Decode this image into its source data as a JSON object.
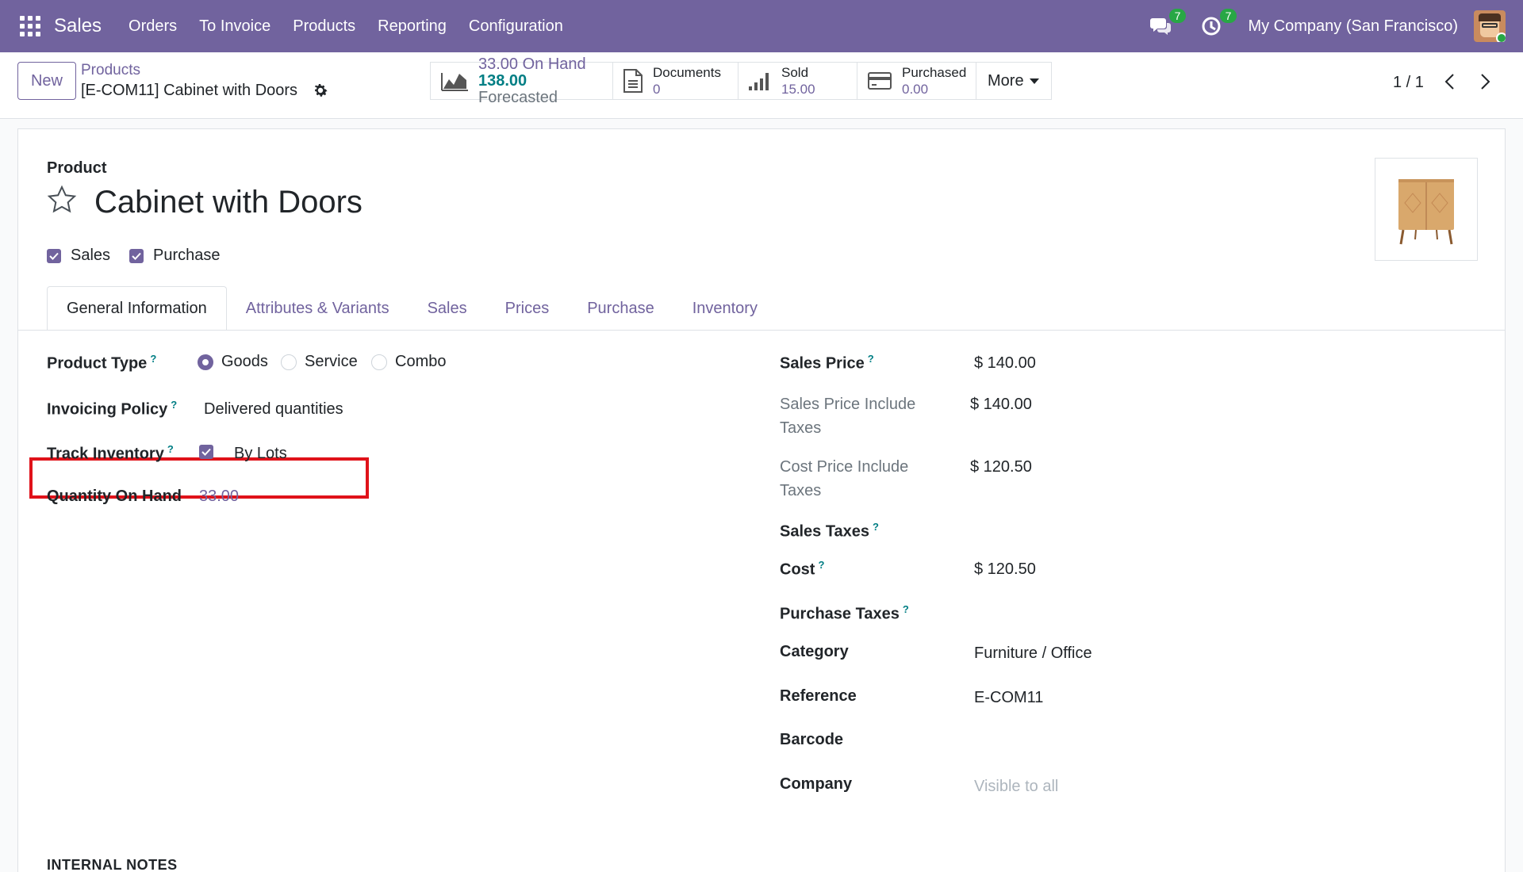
{
  "navbar": {
    "app_name": "Sales",
    "menu": [
      "Orders",
      "To Invoice",
      "Products",
      "Reporting",
      "Configuration"
    ],
    "messages_count": "7",
    "activities_count": "7",
    "company": "My Company (San Francisco)",
    "accent_color": "#71639e"
  },
  "control_panel": {
    "new_label": "New",
    "breadcrumb_parent": "Products",
    "record_title": "[E-COM11] Cabinet with Doors",
    "smart_buttons": {
      "onhand_value": "33.00",
      "onhand_label": "On Hand",
      "forecast_value": "138.00",
      "forecast_label": "Forecasted",
      "documents_label": "Documents",
      "documents_value": "0",
      "sold_label": "Sold",
      "sold_value": "15.00",
      "purchased_label": "Purchased",
      "purchased_value": "0.00",
      "more_label": "More"
    },
    "pager": "1 / 1"
  },
  "form": {
    "product_label": "Product",
    "product_name": "Cabinet with Doors",
    "can_be_sold_label": "Sales",
    "can_be_purchased_label": "Purchase",
    "tabs": [
      "General Information",
      "Attributes & Variants",
      "Sales",
      "Prices",
      "Purchase",
      "Inventory"
    ],
    "active_tab": "General Information",
    "left": {
      "product_type_label": "Product Type",
      "product_type_options": [
        "Goods",
        "Service",
        "Combo"
      ],
      "product_type_selected": "Goods",
      "invoicing_policy_label": "Invoicing Policy",
      "invoicing_policy_value": "Delivered quantities",
      "track_inventory_label": "Track Inventory",
      "track_inventory_value": "By Lots",
      "qty_on_hand_label": "Quantity On Hand",
      "qty_on_hand_value": "33.00"
    },
    "right": {
      "sales_price_label": "Sales Price",
      "sales_price_value": "$ 140.00",
      "sales_price_incl_label_1": "Sales Price Include",
      "sales_price_incl_label_2": "Taxes",
      "sales_price_incl_value": "$ 140.00",
      "cost_price_incl_label_1": "Cost Price Include",
      "cost_price_incl_label_2": "Taxes",
      "cost_price_incl_value": "$ 120.50",
      "sales_taxes_label": "Sales Taxes",
      "cost_label": "Cost",
      "cost_value": "$ 120.50",
      "purchase_taxes_label": "Purchase Taxes",
      "category_label": "Category",
      "category_value": "Furniture / Office",
      "reference_label": "Reference",
      "reference_value": "E-COM11",
      "barcode_label": "Barcode",
      "company_label": "Company",
      "company_placeholder": "Visible to all"
    },
    "help_marker": "?",
    "internal_notes_title": "INTERNAL NOTES"
  }
}
